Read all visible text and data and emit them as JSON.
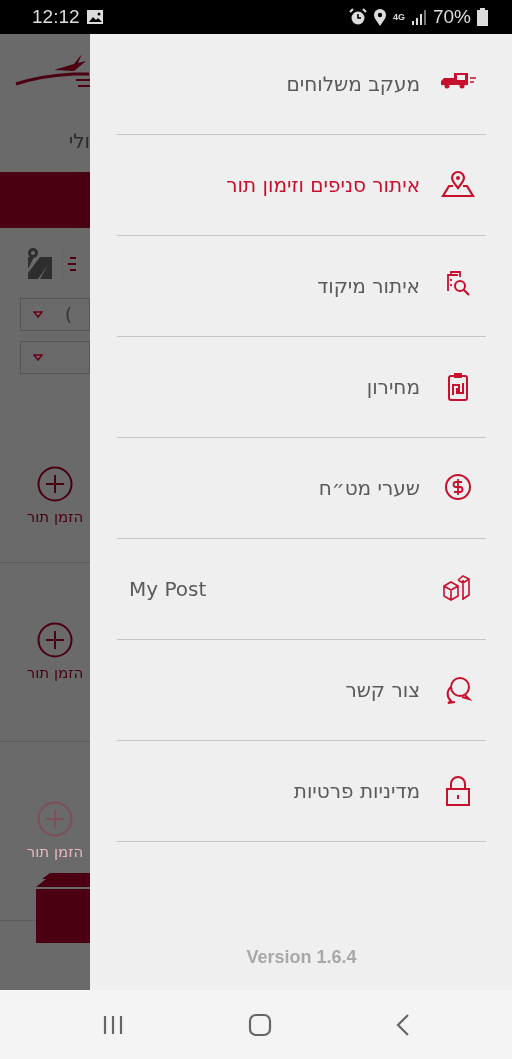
{
  "status_bar": {
    "time": "12:12",
    "network": "4G",
    "battery": "70%"
  },
  "background_page": {
    "heading_fragment": "ולי",
    "dropdown_fragment": "(",
    "branches": [
      {
        "action": "הזמן תור",
        "disabled": false
      },
      {
        "action": "הזמן תור",
        "disabled": false
      },
      {
        "action": "הזמן תור",
        "disabled": true
      }
    ]
  },
  "drawer": {
    "items": [
      {
        "label": "מעקב משלוחים",
        "kind": "truck",
        "selected": false
      },
      {
        "label": "איתור סניפים וזימון תור",
        "kind": "map-pin",
        "selected": true
      },
      {
        "label": "איתור מיקוד",
        "kind": "search-doc",
        "selected": false
      },
      {
        "label": "מחירון",
        "kind": "price-list",
        "selected": false
      },
      {
        "label": "שערי מט״ח",
        "kind": "currency",
        "selected": false
      },
      {
        "label": "My Post",
        "kind": "boxes",
        "selected": false
      },
      {
        "label": "צור קשר",
        "kind": "chat",
        "selected": false
      },
      {
        "label": "מדיניות פרטיות",
        "kind": "lock",
        "selected": false
      }
    ],
    "version": "Version 1.6.4"
  }
}
